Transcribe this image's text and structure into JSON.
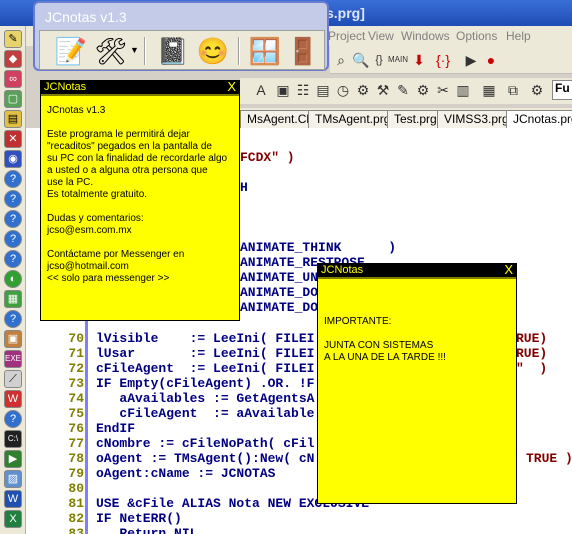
{
  "ide": {
    "title": "rgs.prg]",
    "menu": [
      "Project",
      "View",
      "Windows",
      "Options",
      "Help"
    ],
    "tabs": [
      "MsAgent.Ch",
      "TMsAgent.prg",
      "Test.prg",
      "VIMSS3.prg",
      "JCnotas.prg"
    ],
    "active_tab": "JCnotas.prg",
    "toolbar_font_label": "Fu",
    "code_fragments": [
      {
        "text": "FCDX\" )"
      },
      {
        "text": "H"
      },
      {
        "text": "ANIMATE_THINK      )"
      },
      {
        "text": "ANIMATE_RESTPOSE"
      },
      {
        "text": "ANIMATE_UN"
      },
      {
        "text": "ANIMATE_DO"
      },
      {
        "text": "ANIMATE_DO"
      }
    ],
    "lines": [
      {
        "n": "70",
        "code": "lVisible    := LeeIni( FILEI"
      },
      {
        "n": "71",
        "code": "lUsar       := LeeIni( FILEI"
      },
      {
        "n": "72",
        "code": "cFileAgent  := LeeIni( FILEI"
      },
      {
        "n": "73",
        "code": "IF Empty(cFileAgent) .OR. !F"
      },
      {
        "n": "74",
        "code": "   aAvailables := GetAgentsA"
      },
      {
        "n": "75",
        "code": "   cFileAgent  := aAvailable"
      },
      {
        "n": "76",
        "code": "EndIF"
      },
      {
        "n": "77",
        "code": "cNombre := cFileNoPath( cFil"
      },
      {
        "n": "78",
        "code": "oAgent := TMsAgent():New( cN"
      },
      {
        "n": "79",
        "code": "oAgent:cName := JCNOTAS"
      },
      {
        "n": "80",
        "code": ""
      },
      {
        "n": "81",
        "code": "USE &cFile ALIAS Nota NEW EXCLUSIVE"
      },
      {
        "n": "82",
        "code": "IF NetERR()"
      },
      {
        "n": "83",
        "code": "   Return NIL"
      }
    ],
    "right_fragments": [
      "RUE)",
      "RUE)",
      "\"  )",
      "TRUE )"
    ]
  },
  "toolwin": {
    "title": "JCnotas v1.3"
  },
  "about_note": {
    "title": "JCNotas",
    "close": "X",
    "body": "JCnotas v1.3\n\nEste programa le permitirá dejar\n\"recaditos\" pegados en la pantalla de\nsu PC con la finalidad de recordarle algo\na usted o a alguna otra persona que\nuse la PC.\nEs totalmente gratuito.\n\nDudas y comentarios:\njcso@esm.com.mx\n\nContáctame por Messenger en\njcso@hotmail.com\n<< solo para messenger >>"
  },
  "reminder_note": {
    "title": "JCNotas",
    "close": "X",
    "body": "IMPORTANTE:\n\nJUNTA CON SISTEMAS\nA LA UNA DE LA TARDE !!!"
  }
}
